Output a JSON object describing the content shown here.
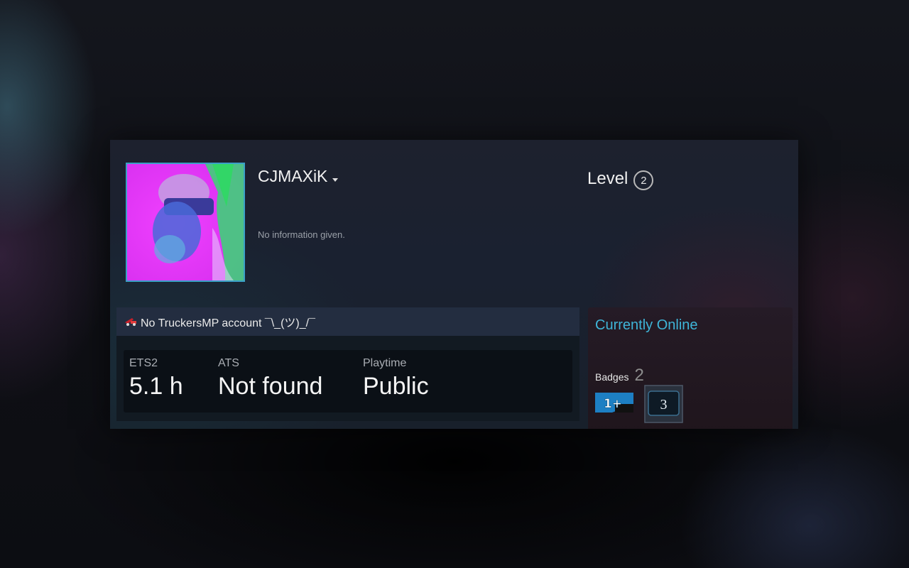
{
  "profile": {
    "username": "CJMAXiK",
    "summary": "No information given.",
    "level_label": "Level",
    "level_value": "2",
    "status": "Currently Online"
  },
  "truckersmp": {
    "header": "No TruckersMP account ¯\\_(ツ)_/¯",
    "stats": [
      {
        "label": "ETS2",
        "value": "5.1 h"
      },
      {
        "label": "ATS",
        "value": "Not found"
      },
      {
        "label": "Playtime",
        "value": "Public"
      }
    ]
  },
  "badges": {
    "label": "Badges",
    "count": "2",
    "items": [
      {
        "text": "1+",
        "icon": "years-of-service-badge-icon"
      },
      {
        "text": "3",
        "icon": "game-collector-badge-icon"
      }
    ]
  },
  "icons": {
    "truck": "truck-icon",
    "caret": "chevron-down-icon"
  },
  "colors": {
    "status_online": "#3fb5d8",
    "avatar_border": "#3aa0c6",
    "panel_header": "#232d40"
  }
}
